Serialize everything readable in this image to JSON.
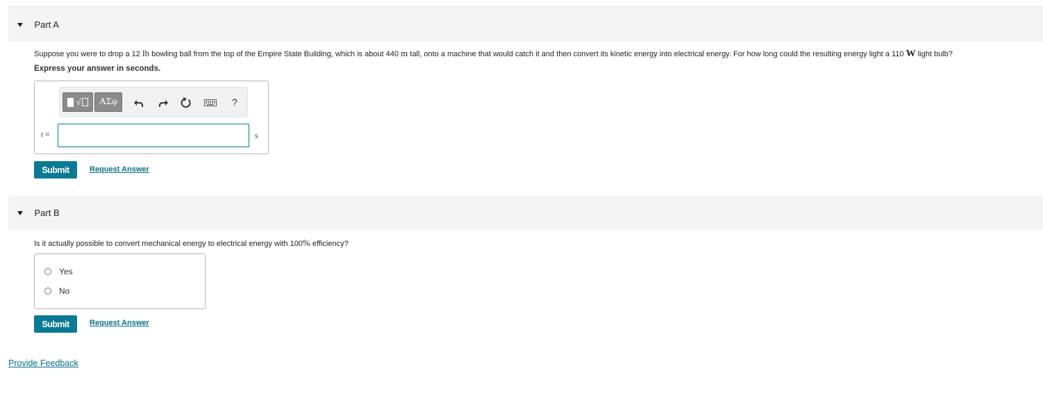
{
  "part_a": {
    "title": "Part A",
    "question": {
      "t1": "Suppose you were to drop a 12 ",
      "u1": "lb",
      "t2": " bowling ball from the top of the Empire State Building, which is about 440 ",
      "u2": "m",
      "t3": " tall, onto a machine that would catch it and then convert its kinetic energy into electrical energy. For how long could the resulting energy light a 110 ",
      "u3": "W",
      "t4": " light bulb?"
    },
    "instruction": "Express your answer in seconds.",
    "toolbar": {
      "symbols_label": "ΑΣφ",
      "help_label": "?",
      "icons": [
        "templates-icon",
        "undo-icon",
        "redo-icon",
        "reset-icon",
        "keyboard-icon",
        "help-icon"
      ]
    },
    "variable": "t",
    "equals": "=",
    "input_value": "",
    "unit": "s",
    "submit_label": "Submit",
    "request_label": "Request Answer"
  },
  "part_b": {
    "title": "Part B",
    "question": {
      "t1": "Is it actually possible to convert mechanical energy to electrical energy with 100",
      "pct": "%",
      "t2": " efficiency?"
    },
    "options": [
      "Yes",
      "No"
    ],
    "submit_label": "Submit",
    "request_label": "Request Answer"
  },
  "feedback_label": "Provide Feedback",
  "colors": {
    "accent": "#0a7a94",
    "header_bg": "#f4f4f4",
    "link": "#0a6f87"
  }
}
